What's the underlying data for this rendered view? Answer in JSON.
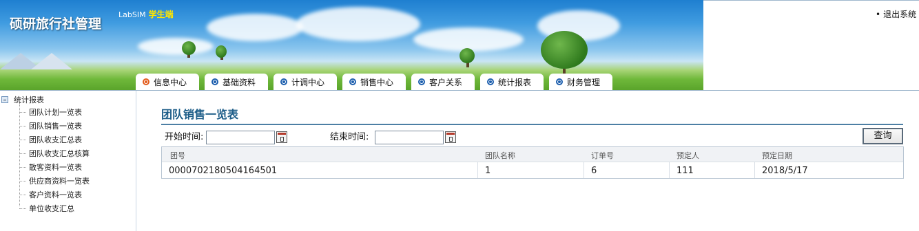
{
  "header": {
    "brand_title": "硕研旅行社管理",
    "brand_product": "LabSIM",
    "brand_role": "学生端",
    "logout_label": "退出系统"
  },
  "nav": {
    "tabs": [
      {
        "label": "信息中心",
        "active": true
      },
      {
        "label": "基础资料",
        "active": false
      },
      {
        "label": "计调中心",
        "active": false
      },
      {
        "label": "销售中心",
        "active": false
      },
      {
        "label": "客户关系",
        "active": false
      },
      {
        "label": "统计报表",
        "active": false
      },
      {
        "label": "财务管理",
        "active": false
      }
    ]
  },
  "sidebar": {
    "root_label": "统计报表",
    "items": [
      {
        "label": "团队计划一览表"
      },
      {
        "label": "团队销售一览表"
      },
      {
        "label": "团队收支汇总表"
      },
      {
        "label": "团队收支汇总核算"
      },
      {
        "label": "散客资料一览表"
      },
      {
        "label": "供应商资料一览表"
      },
      {
        "label": "客户资料一览表"
      },
      {
        "label": "单位收支汇总"
      }
    ]
  },
  "main": {
    "page_title": "团队销售一览表",
    "filters": {
      "start_label": "开始时间:",
      "start_value": "",
      "end_label": "结束时间:",
      "end_value": "",
      "query_label": "查询"
    },
    "table": {
      "columns": [
        "团号",
        "团队名称",
        "订单号",
        "预定人",
        "预定日期"
      ],
      "rows": [
        [
          "0000702180504164501",
          "1",
          "6",
          "111",
          "2018/5/17"
        ]
      ]
    }
  },
  "colors": {
    "title_blue": "#1d5d88",
    "active_tab_dot": "#e35d1e",
    "tab_dot": "#1d5fae"
  }
}
